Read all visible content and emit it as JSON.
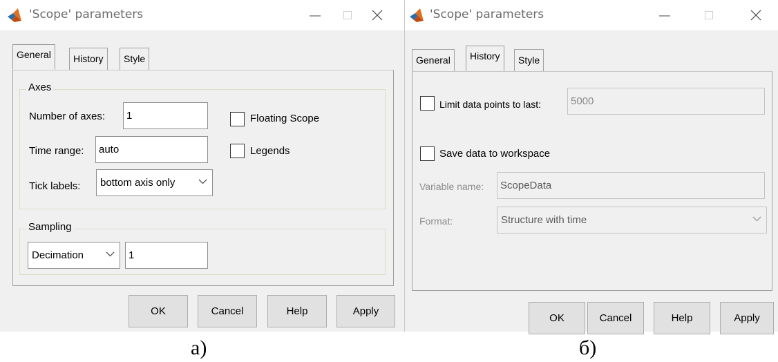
{
  "dialogA": {
    "title": "'Scope' parameters",
    "tabs": [
      "General",
      "History",
      "Style"
    ],
    "axes": {
      "group_label": "Axes",
      "num_axes_label": "Number of axes:",
      "num_axes_value": "1",
      "time_range_label": "Time range:",
      "time_range_value": "auto",
      "tick_labels_label": "Tick labels:",
      "tick_labels_value": "bottom axis only",
      "floating_scope_label": "Floating Scope",
      "legends_label": "Legends"
    },
    "sampling": {
      "group_label": "Sampling",
      "mode_value": "Decimation",
      "factor_value": "1"
    },
    "buttons": {
      "ok": "OK",
      "cancel": "Cancel",
      "help": "Help",
      "apply": "Apply"
    },
    "caption": "а)"
  },
  "dialogB": {
    "title": "'Scope' parameters",
    "tabs": [
      "General",
      "History",
      "Style"
    ],
    "limit_label": "Limit data points to last:",
    "limit_value": "5000",
    "save_label": "Save data to workspace",
    "variable_name_label": "Variable name:",
    "variable_name_value": "ScopeData",
    "format_label": "Format:",
    "format_value": "Structure with time",
    "buttons": {
      "ok": "OK",
      "cancel": "Cancel",
      "help": "Help",
      "apply": "Apply"
    },
    "caption": "б)"
  },
  "icons": {
    "app": "matlab-icon",
    "minimize": "minimize-icon",
    "maximize": "maximize-icon",
    "close": "close-icon",
    "dropdown": "chevron-down-icon"
  },
  "colors": {
    "dialog_bg": "#f0f0f0",
    "titlebar_bg": "#ffffff",
    "button_bg": "#e1e1e1",
    "disabled_text": "#8c8c8c"
  }
}
